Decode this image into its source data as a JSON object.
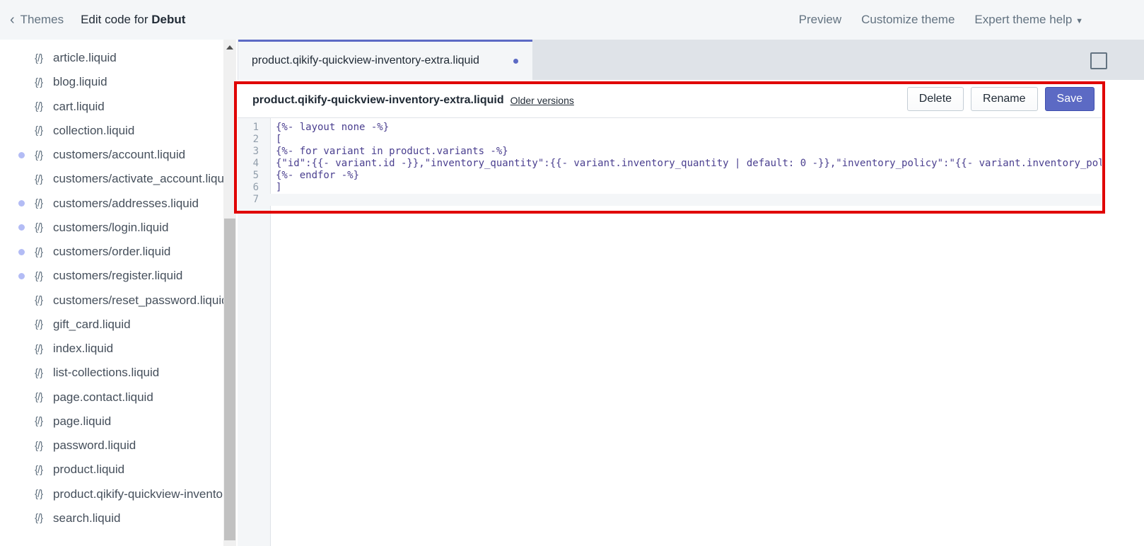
{
  "topbar": {
    "back_label": "Themes",
    "title_prefix": "Edit code for ",
    "theme_name": "Debut",
    "links": [
      "Preview",
      "Customize theme",
      "Expert theme help"
    ]
  },
  "sidebar": {
    "items": [
      {
        "label": "article.liquid",
        "modified": false
      },
      {
        "label": "blog.liquid",
        "modified": false
      },
      {
        "label": "cart.liquid",
        "modified": false
      },
      {
        "label": "collection.liquid",
        "modified": false
      },
      {
        "label": "customers/account.liquid",
        "modified": true
      },
      {
        "label": "customers/activate_account.liquid",
        "modified": false
      },
      {
        "label": "customers/addresses.liquid",
        "modified": true
      },
      {
        "label": "customers/login.liquid",
        "modified": true
      },
      {
        "label": "customers/order.liquid",
        "modified": true
      },
      {
        "label": "customers/register.liquid",
        "modified": true
      },
      {
        "label": "customers/reset_password.liquid",
        "modified": false
      },
      {
        "label": "gift_card.liquid",
        "modified": false
      },
      {
        "label": "index.liquid",
        "modified": false
      },
      {
        "label": "list-collections.liquid",
        "modified": false
      },
      {
        "label": "page.contact.liquid",
        "modified": false
      },
      {
        "label": "page.liquid",
        "modified": false
      },
      {
        "label": "password.liquid",
        "modified": false
      },
      {
        "label": "product.liquid",
        "modified": false
      },
      {
        "label": "product.qikify-quickview-inventory-extra.liquid",
        "modified": false
      },
      {
        "label": "search.liquid",
        "modified": false
      }
    ],
    "icon": "{/}"
  },
  "tab": {
    "label": "product.qikify-quickview-inventory-extra.liquid",
    "unsaved": true
  },
  "editor": {
    "file_name": "product.qikify-quickview-inventory-extra.liquid",
    "older_versions": "Older versions",
    "buttons": {
      "delete": "Delete",
      "rename": "Rename",
      "save": "Save"
    },
    "lines": [
      "{%- layout none -%}",
      "[",
      "{%- for variant in product.variants -%}",
      "{\"id\":{{- variant.id -}},\"inventory_quantity\":{{- variant.inventory_quantity | default: 0 -}},\"inventory_policy\":\"{{- variant.inventory_policy -}}\"}{%- unless forloop.last -%},{%- endunless -%}",
      "{%- endfor -%}",
      "]",
      ""
    ]
  },
  "colors": {
    "accent": "#5c6ac4",
    "highlight_box": "#e00000"
  }
}
